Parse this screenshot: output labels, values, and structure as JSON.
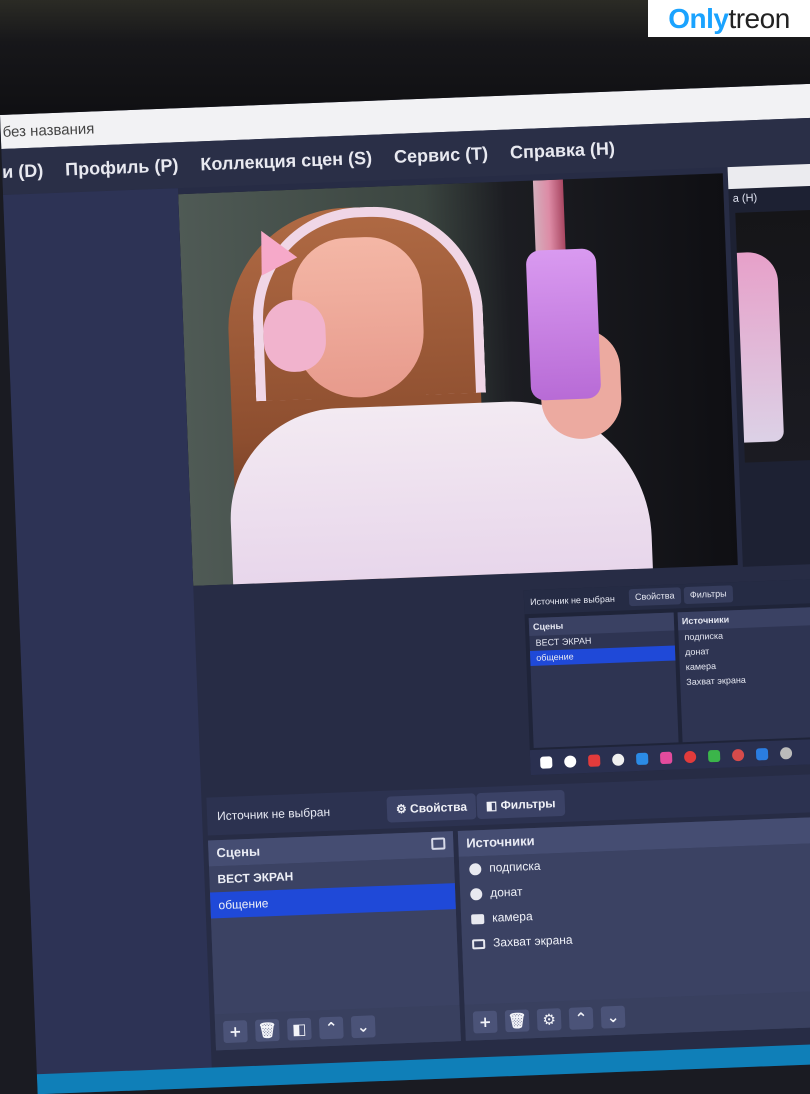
{
  "watermark": {
    "part1": "Only",
    "part2": "treon"
  },
  "window": {
    "title": "без названия"
  },
  "menu": {
    "items": [
      "и (D)",
      "Профиль (P)",
      "Коллекция сцен (S)",
      "Сервис (T)",
      "Справка (H)"
    ]
  },
  "mini_window": {
    "title_partial": "a (H)",
    "status": "Источник не выбран",
    "properties": "Свойства",
    "filters": "Фильтры",
    "scenes_title": "Сцены",
    "sources_title": "Источники",
    "scenes": [
      "ВЕСТ ЭКРАН",
      "общение"
    ],
    "sources": [
      "подписка",
      "донат",
      "камера",
      "Захват экрана"
    ]
  },
  "toolbar": {
    "status": "Источник не выбран",
    "properties_label": "Свойства",
    "filters_label": "Фильтры"
  },
  "scenes": {
    "title": "Сцены",
    "items": [
      {
        "label": "ВЕСТ ЭКРАН",
        "selected": false
      },
      {
        "label": "общение",
        "selected": true
      }
    ],
    "footer": {
      "add": "+",
      "remove": "🗑",
      "filter": "◧",
      "up": "⌃",
      "down": "⌄"
    }
  },
  "sources": {
    "title": "Источники",
    "items": [
      {
        "label": "подписка",
        "icon": "browser-icon"
      },
      {
        "label": "донат",
        "icon": "browser-icon"
      },
      {
        "label": "камера",
        "icon": "camera-icon"
      },
      {
        "label": "Захват экрана",
        "icon": "monitor-icon"
      }
    ],
    "footer": {
      "add": "+",
      "remove": "🗑",
      "settings": "⚙",
      "up": "⌃",
      "down": "⌄"
    }
  },
  "colors": {
    "selection": "#1f49d8",
    "panel": "#39405f",
    "menubar": "#2a2f47",
    "watermark_blue": "#1aa3ff"
  }
}
